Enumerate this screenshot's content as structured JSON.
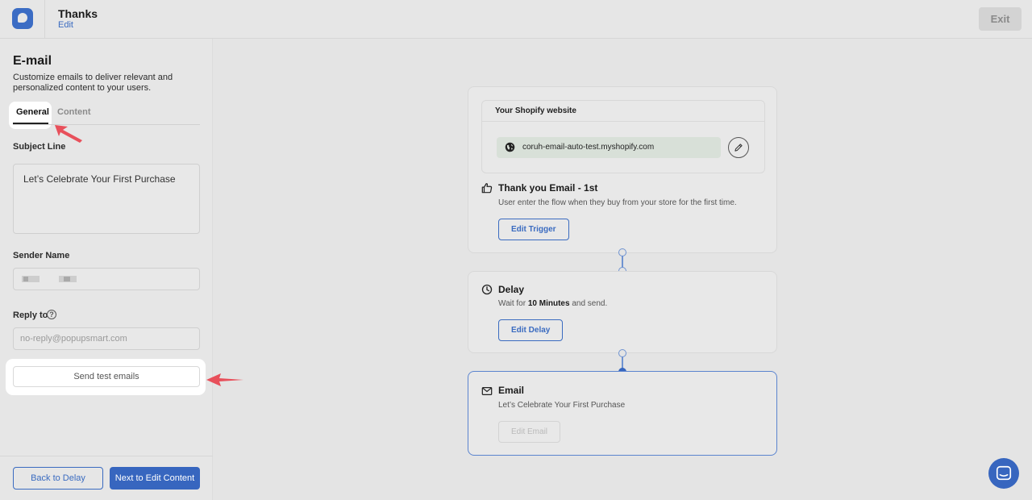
{
  "header": {
    "title": "Thanks",
    "edit_label": "Edit",
    "exit_label": "Exit"
  },
  "sidebar": {
    "title": "E-mail",
    "description": "Customize emails to deliver relevant and personalized content to your users.",
    "tabs": [
      {
        "label": "General",
        "active": true
      },
      {
        "label": "Content",
        "active": false
      }
    ],
    "subject": {
      "label": "Subject Line",
      "value": "Let’s Celebrate Your First Purchase"
    },
    "sender": {
      "label": "Sender Name"
    },
    "reply_to": {
      "label": "Reply to",
      "placeholder": "no-reply@popupsmart.com"
    },
    "send_test_label": "Send test emails",
    "back_label": "Back to Delay",
    "next_label": "Next to Edit Content"
  },
  "flow": {
    "site": {
      "title": "Your Shopify website",
      "url": "coruh-email-auto-test.myshopify.com"
    },
    "trigger": {
      "title": "Thank you Email - 1st",
      "description": "User enter the flow when they buy from your store for the first time.",
      "button": "Edit Trigger"
    },
    "delay": {
      "title": "Delay",
      "desc_prefix": "Wait for",
      "desc_value": "10 Minutes",
      "desc_suffix": "and send.",
      "button": "Edit Delay"
    },
    "email": {
      "title": "Email",
      "subject": "Let’s Celebrate Your First Purchase",
      "button": "Edit Email"
    }
  },
  "colors": {
    "accent": "#3766bf",
    "annotation_arrow": "#e8505b"
  },
  "icons": [
    "app-logo-icon",
    "help-icon",
    "globe-icon",
    "pencil-icon",
    "thumbs-up-icon",
    "clock-icon",
    "mail-icon",
    "chat-icon"
  ]
}
